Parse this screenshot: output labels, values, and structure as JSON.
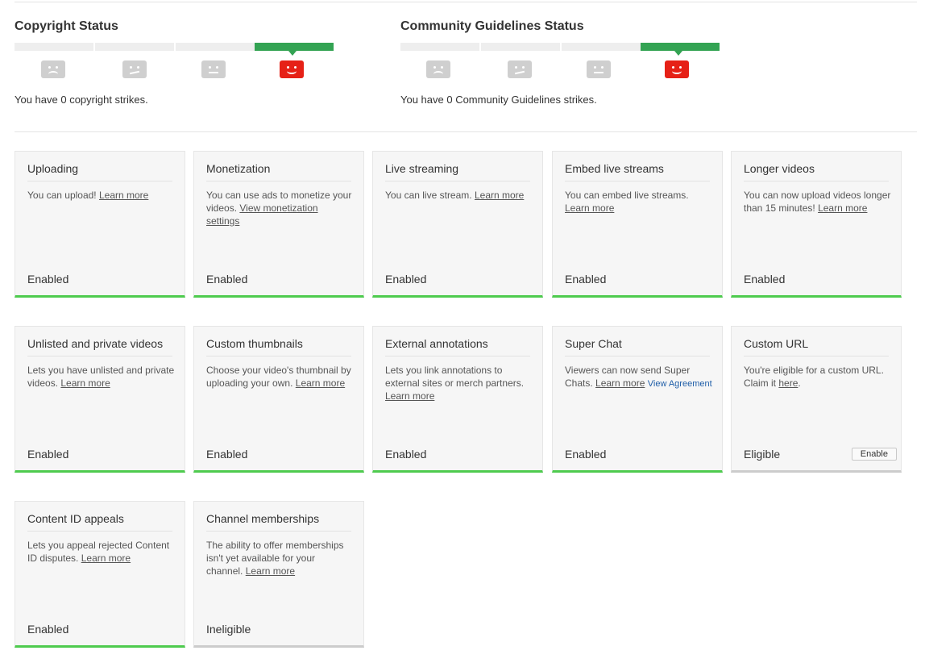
{
  "copyright": {
    "title": "Copyright Status",
    "text": "You have 0 copyright strikes.",
    "active_segment": 4
  },
  "community": {
    "title": "Community Guidelines Status",
    "text": "You have 0 Community Guidelines strikes.",
    "active_segment": 4
  },
  "colors": {
    "enabled_bar": "#4ecb4e",
    "status_bar_active": "#33a353",
    "face_active": "#e62117",
    "face_inactive": "#cfcfcf",
    "link_blue": "#1f5ea8"
  },
  "cards": [
    {
      "title": "Uploading",
      "desc": "You can upload!",
      "link": "Learn more",
      "status": "Enabled"
    },
    {
      "title": "Monetization",
      "desc": "You can use ads to monetize your videos.",
      "link": "View monetization settings",
      "status": "Enabled"
    },
    {
      "title": "Live streaming",
      "desc": "You can live stream.",
      "link": "Learn more",
      "status": "Enabled"
    },
    {
      "title": "Embed live streams",
      "desc": "You can embed live streams.",
      "link": "Learn more",
      "status": "Enabled"
    },
    {
      "title": "Longer videos",
      "desc": "You can now upload videos longer than 15 minutes!",
      "link": "Learn more",
      "status": "Enabled"
    },
    {
      "title": "Unlisted and private videos",
      "desc": "Lets you have unlisted and private videos.",
      "link": "Learn more",
      "status": "Enabled"
    },
    {
      "title": "Custom thumbnails",
      "desc": "Choose your video's thumbnail by uploading your own.",
      "link": "Learn more",
      "status": "Enabled"
    },
    {
      "title": "External annotations",
      "desc": "Lets you link annotations to external sites or merch partners.",
      "link": "Learn more",
      "status": "Enabled"
    },
    {
      "title": "Super Chat",
      "desc": "Viewers can now send Super Chats.",
      "link": "Learn more",
      "link2": "View Agreement",
      "status": "Enabled"
    },
    {
      "title": "Custom URL",
      "desc": "You're eligible for a custom URL. Claim it",
      "link": "here",
      "suffix": ".",
      "status": "Eligible",
      "button": "Enable"
    },
    {
      "title": "Content ID appeals",
      "desc": "Lets you appeal rejected Content ID disputes.",
      "link": "Learn more",
      "status": "Enabled"
    },
    {
      "title": "Channel memberships",
      "desc": "The ability to offer memberships isn't yet available for your channel.",
      "link": "Learn more",
      "status": "Ineligible"
    }
  ]
}
